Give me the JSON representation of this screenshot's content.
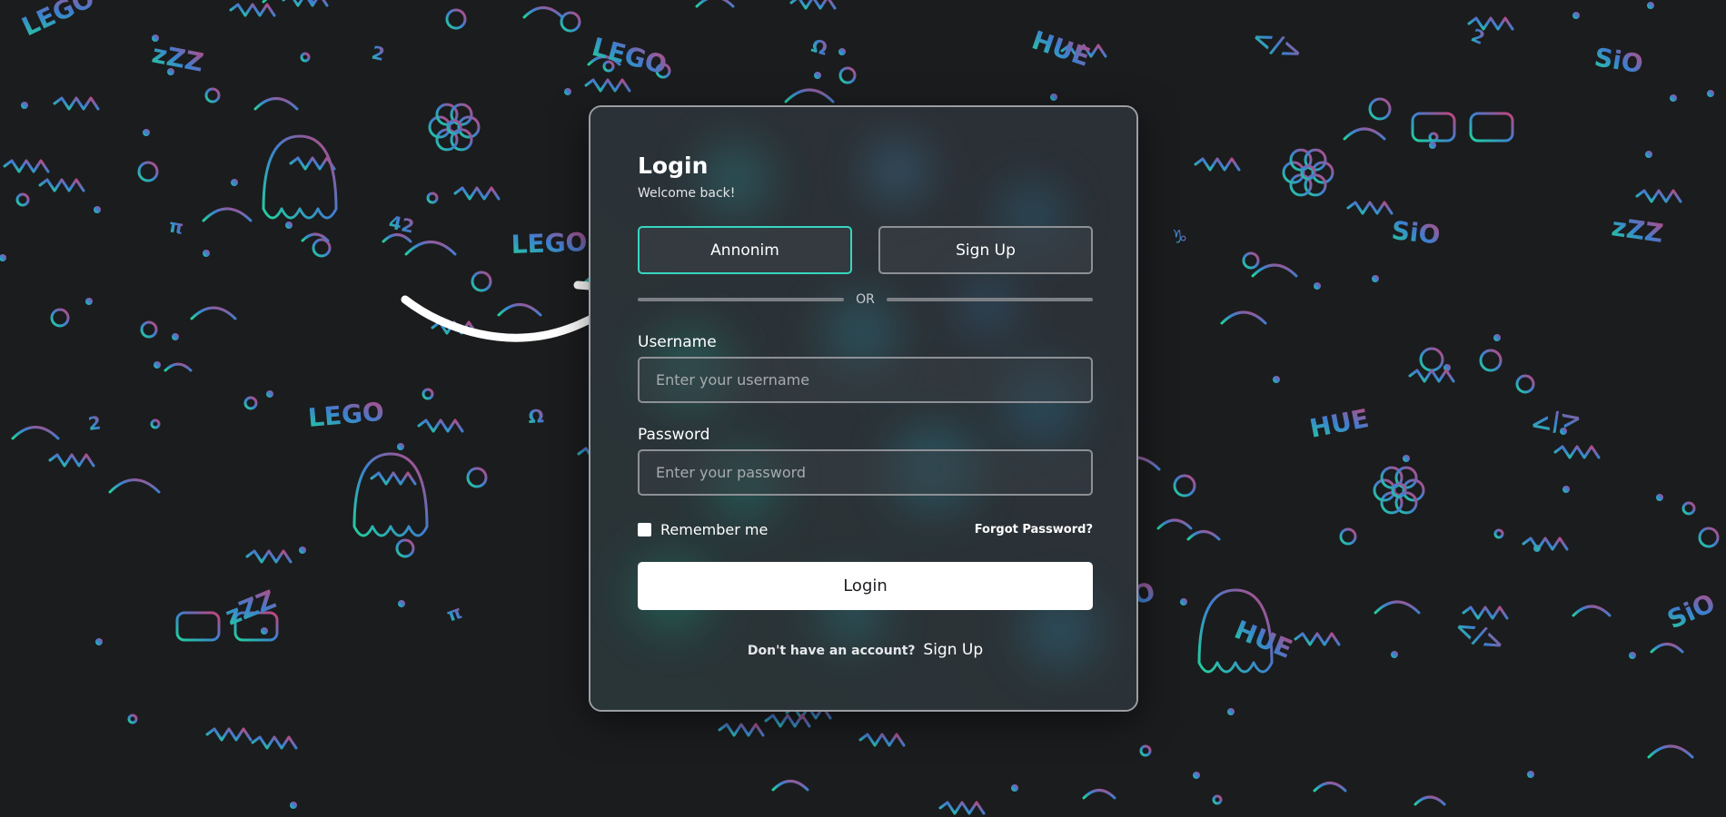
{
  "colors": {
    "background": "#1b1c1e",
    "accent": "#37d6c0",
    "doodle_gradient_start": "#21d29c",
    "doodle_gradient_mid": "#3d7fd0",
    "doodle_gradient_end": "#c84378"
  },
  "background_doodles": {
    "texts": [
      "LEGO",
      "42",
      "HUE",
      "SiO",
      "2",
      "π",
      "Ω",
      "♑",
      "</>",
      "zZZ",
      "LEGO",
      "42",
      "HUE",
      "SiO",
      "2",
      "π",
      "Ω",
      "♑",
      "</>",
      "zZZ",
      "LEGO",
      "42",
      "HUE",
      "SiO",
      "2",
      "Ω",
      "♑",
      "</>",
      "zZZ",
      "LEGO",
      "42",
      "HUE",
      "SiO"
    ]
  },
  "login": {
    "title": "Login",
    "subtitle": "Welcome back!",
    "anonymous_button": "Annonim",
    "signup_button": "Sign Up",
    "or_text": "OR",
    "username_label": "Username",
    "username_placeholder": "Enter your username",
    "username_value": "",
    "password_label": "Password",
    "password_placeholder": "Enter your password",
    "password_value": "",
    "remember_label": "Remember me",
    "remember_checked": false,
    "forgot_link": "Forgot Password?",
    "submit_button": "Login",
    "no_account_text": "Don't have an account?",
    "signup_link": "Sign Up"
  },
  "icons": {
    "arrow": "curved-arrow-icon",
    "checkbox": "checkbox-icon"
  }
}
